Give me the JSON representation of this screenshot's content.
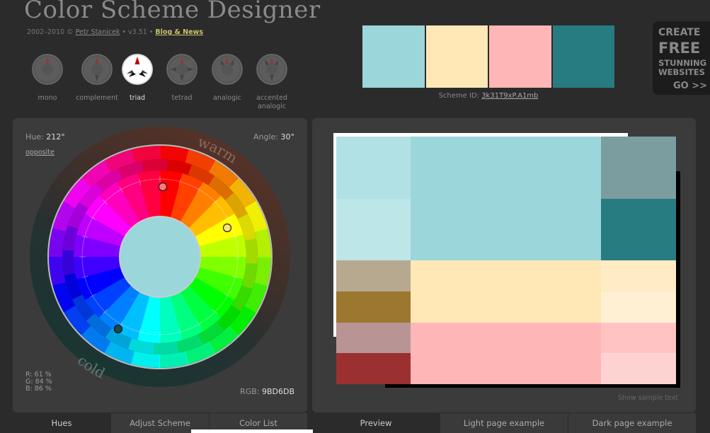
{
  "header": {
    "title": "Color Scheme Designer",
    "credits_prefix": "2002–2010 © ",
    "author": "Petr Stanicek",
    "version": " • v3.51 • ",
    "blog_link": "Blog & News"
  },
  "modes": [
    {
      "label": "mono"
    },
    {
      "label": "complement"
    },
    {
      "label": "triad"
    },
    {
      "label": "tetrad"
    },
    {
      "label": "analogic"
    },
    {
      "label": "accented analogic"
    }
  ],
  "active_mode": "triad",
  "scheme": {
    "swatches": [
      "#9bd6db",
      "#ffe8b6",
      "#ffb6b6",
      "#277c82"
    ],
    "id_label": "Scheme ID: ",
    "id_value": "3k31T9xP.A1mb"
  },
  "ad": {
    "line1": "CREATE",
    "line2": "FREE",
    "line3": "STUNNING",
    "line4": "WEBSITES",
    "cta": "GO >>"
  },
  "wheel": {
    "hue_label": "Hue:",
    "hue_value": "212°",
    "opposite_link": "opposite",
    "angle_label": "Angle:",
    "angle_value": "30°",
    "warm_label": "warm",
    "cold_label": "cold",
    "r_line": "R: 61 %",
    "g_line": "G: 84 %",
    "b_line": "B: 86 %",
    "rgb_label": "RGB:",
    "rgb_value": "9BD6DB",
    "center_color": "#9bd6db"
  },
  "preview": {
    "cells": [
      {
        "color": "#b2e1e5"
      },
      {
        "color": "#9bd6db"
      },
      {
        "color": "#7c9da0"
      },
      {
        "color": "#bde6e9"
      },
      {
        "color": "#277c82"
      },
      {
        "color": "#b7a98f"
      },
      {
        "color": "#ffe8b6"
      },
      {
        "color": "#ffebc4"
      },
      {
        "color": "#9b7730"
      },
      {
        "color": "#fff0d4"
      },
      {
        "color": "#b99494"
      },
      {
        "color": "#ffb6b6"
      },
      {
        "color": "#ffc3c3"
      },
      {
        "color": "#9b3030"
      },
      {
        "color": "#ffd2d2"
      }
    ],
    "sample_text_link": "Show sample text"
  },
  "tabs_left": [
    {
      "label": "Hues"
    },
    {
      "label": "Adjust Scheme"
    },
    {
      "label": "Color List"
    }
  ],
  "tabs_right": [
    {
      "label": "Preview"
    },
    {
      "label": "Light page example"
    },
    {
      "label": "Dark page example"
    }
  ]
}
